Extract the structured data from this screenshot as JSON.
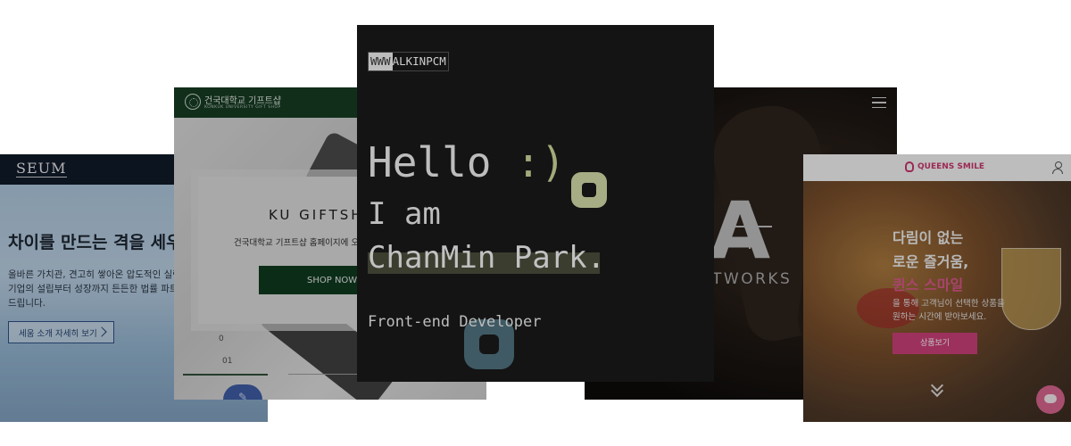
{
  "seum": {
    "logo": "SEUM",
    "headline": "차이를 만드는 격을 세우",
    "desc_line1": "올바른 가치관, 견고히 쌓아온 압도적인 실력을",
    "desc_line2": "기업의 설립부터 성장까지 든든한 법률 파트너",
    "desc_line3": "드립니다.",
    "button": "세움 소개 자세히 보기"
  },
  "ku": {
    "brand": "건국대학교 기프트샵",
    "brand_sub": "KONKUK UNIVERSITY GIFT SHOP",
    "title": "KU GIFTSH",
    "subtitle": "건국대학교 기프트샵 홈페이지에 오",
    "shop_button": "SHOP NOW",
    "slide_zero": "0",
    "slide_num": "01"
  },
  "main": {
    "logo_a": "WWW",
    "logo_b": "ALKINPCM",
    "hello": "Hello ",
    "smile": ":)",
    "iam": "I am",
    "name": "ChanMin Park.",
    "role": "Front-end Developer"
  },
  "ka": {
    "big": "A E",
    "networks": "TWORKS"
  },
  "qs": {
    "brand": "QUEENS SMILE",
    "line1": "다림이 없는",
    "line2": "로운 즐거움,",
    "pink": "퀸스 스마일",
    "desc1": "을 통해 고객님이 선택한 상품을",
    "desc2": "원하는 시간에 받아보세요.",
    "button": "상품보기"
  }
}
